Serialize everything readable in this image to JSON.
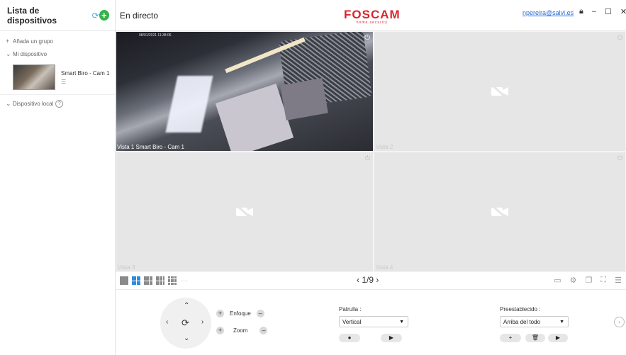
{
  "sidebar": {
    "title": "Lista de dispositivos",
    "add_group": "Añada un grupo",
    "my_device": "Mi dispositivo",
    "device_name": "Smart Biro - Cam 1",
    "local_device": "Dispositivo local"
  },
  "header": {
    "live_title": "En directo",
    "logo": "FOSCAM",
    "logo_sub": "home security",
    "user": "npereira@salvi.es"
  },
  "grid": {
    "cells": [
      {
        "label": "Vista 1 Smart Biro - Cam 1",
        "stamp": "08/01/2021 11:38:06"
      },
      {
        "label": "Vista 2"
      },
      {
        "label": "Vista 3"
      },
      {
        "label": "Vista 4"
      }
    ]
  },
  "pager": "1/9",
  "controls": {
    "focus": "Enfoque",
    "zoom": "Zoom",
    "patrol_label": "Patrulla :",
    "patrol_value": "Vertical",
    "preset_label": "Preestablecido :",
    "preset_value": "Arriba del todo"
  },
  "icons": {
    "refresh": "refresh-icon",
    "add": "plus-circle-icon",
    "camera_off": "camera-off-icon",
    "lock": "lock-icon"
  }
}
